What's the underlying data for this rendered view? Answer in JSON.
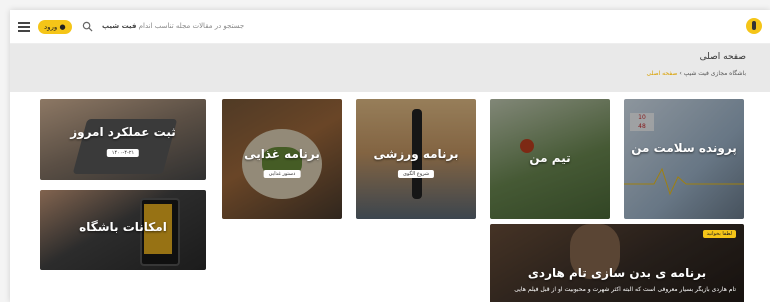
{
  "topbar": {
    "login_label": "ورود",
    "search_text_prefix": "جستجو در مقالات مجله تناسب اندام",
    "search_text_brand": "فیت شیپ"
  },
  "hero": {
    "title": "صفحه اصلی",
    "breadcrumb_parent": "باشگاه مجازی فیت شیپ",
    "breadcrumb_separator": "›",
    "breadcrumb_current": "صفحه اصلی"
  },
  "cards": {
    "health_file": {
      "title": "پرونده سلامت من",
      "metric_a": "10",
      "metric_b": "48"
    },
    "my_team": {
      "title": "تیم من"
    },
    "workout": {
      "title": "برنامه ورزشی",
      "tag": "شروع الگوی"
    },
    "diet": {
      "title": "برنامه غذایی",
      "tag": "دستور غذایی"
    },
    "daily_log": {
      "title": "ثبت عملکرد امروز",
      "date": "۱۴۰۰-۴-۲۱"
    },
    "club_features": {
      "title": "امکانات باشگاه"
    },
    "hardy": {
      "badge": "لطفا بخوانید",
      "title": "برنامه ی بدن سازی تام هاردی",
      "desc": "تام هاردی بازیگر بسیار معروفی است که البته اکثر شهرت و محبوبیت او از قبل فیلم هایی"
    }
  },
  "colors": {
    "accent": "#f5c518",
    "link": "#d9a000"
  }
}
